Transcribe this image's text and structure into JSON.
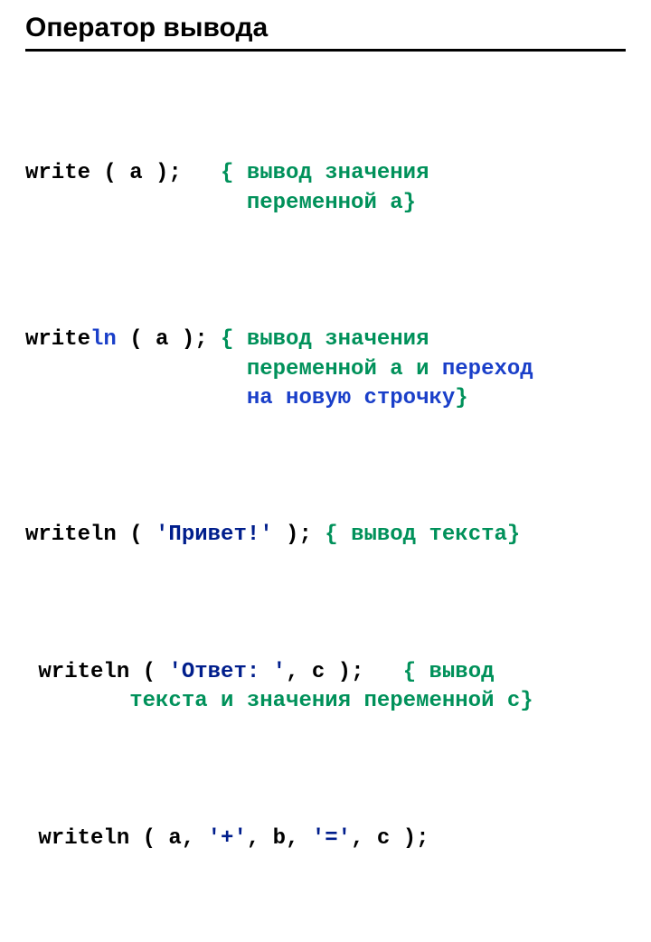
{
  "title": "Оператор вывода",
  "lines": {
    "l1a": "write",
    "l1b": " ( a );   ",
    "l1c": "{ вывод значения\n                 переменной a}",
    "l2a": "write",
    "l2b": "ln",
    "l2c": " ( a ); ",
    "l2d": "{ вывод значения\n                 переменной a и ",
    "l2e": "переход\n                 на новую строчку",
    "l2f": "}",
    "l3a": "writeln ( ",
    "l3b": "'Привет!'",
    "l3c": " ); ",
    "l3d": "{ вывод текста}",
    "l4a": " writeln ( ",
    "l4b": "'Ответ: '",
    "l4c": ", c );   ",
    "l4d": "{ вывод\n        текста и значения переменной c}",
    "l5a": " writeln ( a, ",
    "l5b": "'+'",
    "l5c": ", b, ",
    "l5d": "'='",
    "l5e": ", c );"
  }
}
